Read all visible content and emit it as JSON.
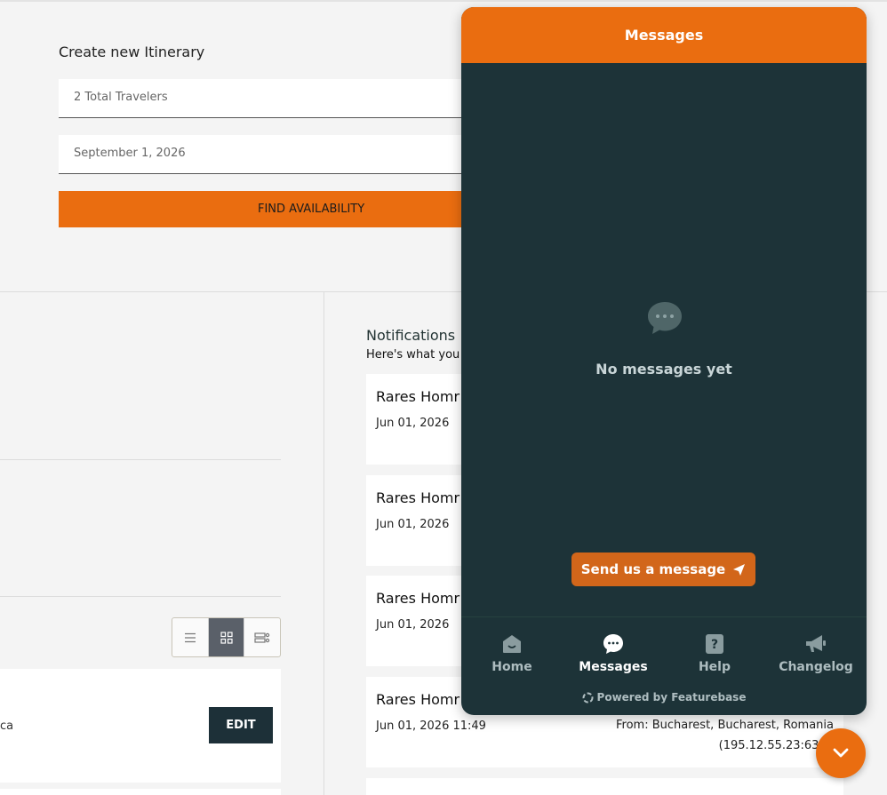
{
  "itinerary": {
    "title": "Create new Itinerary",
    "travelers_value": "2 Total Travelers",
    "date_value": "September 1, 2026",
    "find_button": "FIND AVAILABILITY"
  },
  "left_card": {
    "partial_text": "ca",
    "edit_button": "EDIT"
  },
  "notifications": {
    "title": "Notifications",
    "subtitle": "Here's what you h",
    "items": [
      {
        "name": "Rares Homr",
        "date": "Jun 01, 2026",
        "from_line1": "",
        "from_line2": ""
      },
      {
        "name": "Rares Homr",
        "date": "Jun 01, 2026",
        "from_line1": "",
        "from_line2": ""
      },
      {
        "name": "Rares Homr",
        "date": "Jun 01, 2026",
        "from_line1": "",
        "from_line2": ""
      },
      {
        "name": "Rares Homr",
        "date": "Jun 01, 2026 11:49",
        "from_line1": "From: Bucharest, Bucharest, Romania",
        "from_line2": "(195.12.55.23:6386"
      }
    ]
  },
  "widget": {
    "header_title": "Messages",
    "empty_text": "No messages yet",
    "send_button": "Send us a message",
    "nav": [
      {
        "label": "Home",
        "icon": "home-icon"
      },
      {
        "label": "Messages",
        "icon": "chat-icon"
      },
      {
        "label": "Help",
        "icon": "help-icon"
      },
      {
        "label": "Changelog",
        "icon": "megaphone-icon"
      }
    ],
    "powered_by": "Powered by Featurebase"
  },
  "colors": {
    "accent": "#ea6d10",
    "widget_bg": "#1d3338",
    "dark_button": "#1d3038"
  }
}
